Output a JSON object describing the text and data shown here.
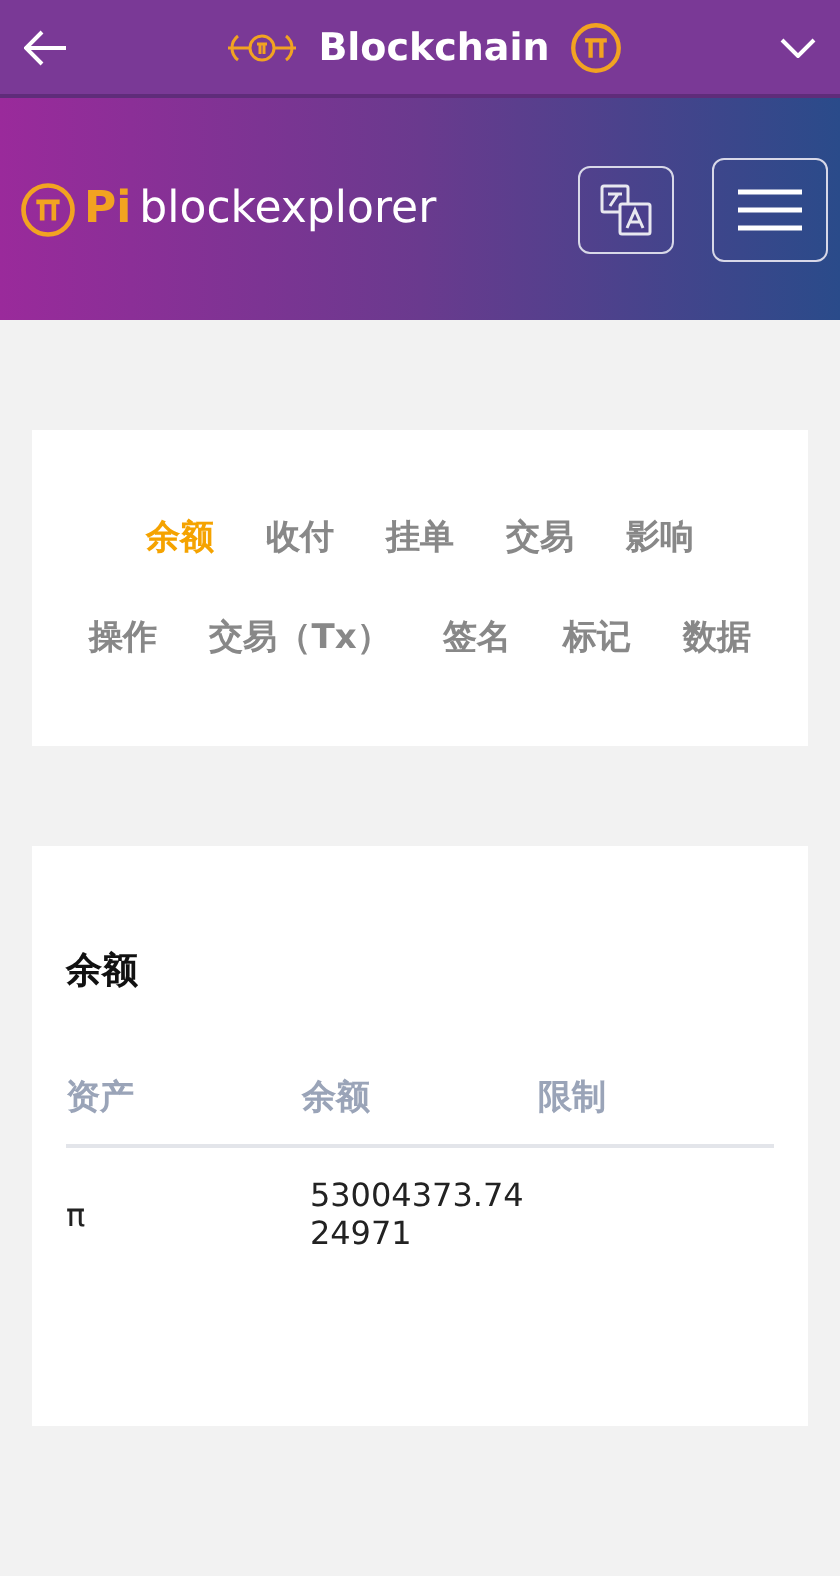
{
  "top_bar": {
    "title": "Blockchain"
  },
  "header": {
    "logo_prefix": "Pi",
    "logo_text": "blockexplorer"
  },
  "tabs": [
    {
      "label": "余额",
      "selected": true
    },
    {
      "label": "收付",
      "selected": false
    },
    {
      "label": "挂单",
      "selected": false
    },
    {
      "label": "交易",
      "selected": false
    },
    {
      "label": "影响",
      "selected": false
    },
    {
      "label": "操作",
      "selected": false
    },
    {
      "label": "交易（Tx）",
      "selected": false
    },
    {
      "label": "签名",
      "selected": false
    },
    {
      "label": "标记",
      "selected": false
    },
    {
      "label": "数据",
      "selected": false
    }
  ],
  "balance_card": {
    "title": "余额",
    "columns": [
      "资产",
      "余额",
      "限制"
    ],
    "rows": [
      [
        "π",
        "53004373.7424971",
        ""
      ]
    ]
  }
}
